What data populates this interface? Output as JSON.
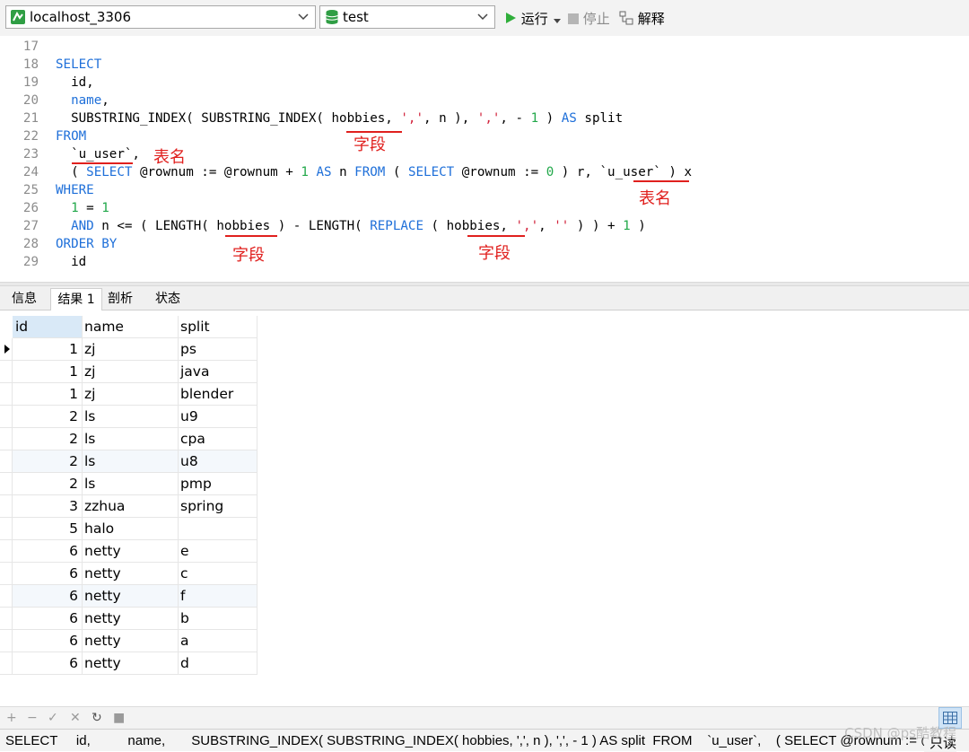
{
  "toolbar": {
    "connection": "localhost_3306",
    "database": "test",
    "run_label": "运行",
    "stop_label": "停止",
    "explain_label": "解释"
  },
  "editor": {
    "lines": [
      {
        "n": "17",
        "html": ""
      },
      {
        "n": "18",
        "html": "<span class='kw'>SELECT</span>"
      },
      {
        "n": "19",
        "html": "  id,"
      },
      {
        "n": "20",
        "html": "  <span class='kw'>name</span>,"
      },
      {
        "n": "21",
        "html": "  SUBSTRING_INDEX( SUBSTRING_INDEX( hobbies, <span class='str'>','</span>, n ), <span class='str'>','</span>, - <span class='num'>1</span> ) <span class='kw'>AS</span> split"
      },
      {
        "n": "22",
        "html": "<span class='kw'>FROM</span>"
      },
      {
        "n": "23",
        "html": "  `u_user`,"
      },
      {
        "n": "24",
        "html": "  ( <span class='kw'>SELECT</span> @rownum := @rownum + <span class='num'>1</span> <span class='kw'>AS</span> n <span class='kw'>FROM</span> ( <span class='kw'>SELECT</span> @rownum := <span class='num'>0</span> ) r, `u_user` ) x"
      },
      {
        "n": "25",
        "html": "<span class='kw'>WHERE</span>"
      },
      {
        "n": "26",
        "html": "  <span class='num'>1</span> = <span class='num'>1</span>"
      },
      {
        "n": "27",
        "html": "  <span class='kw'>AND</span> n <= ( LENGTH( hobbies ) - LENGTH( <span class='kw'>REPLACE</span> ( hobbies, <span class='str'>','</span>, <span class='str'>''</span> ) ) + <span class='num'>1</span> )"
      },
      {
        "n": "28",
        "html": "<span class='kw'>ORDER BY</span>"
      },
      {
        "n": "29",
        "html": "  id"
      }
    ],
    "annotations": {
      "field": "字段",
      "table": "表名"
    }
  },
  "tabs": [
    "信息",
    "结果 1",
    "剖析",
    "状态"
  ],
  "grid": {
    "columns": [
      "id",
      "name",
      "split"
    ],
    "rows": [
      {
        "id": "1",
        "name": "zj",
        "split": "ps"
      },
      {
        "id": "1",
        "name": "zj",
        "split": "java"
      },
      {
        "id": "1",
        "name": "zj",
        "split": "blender"
      },
      {
        "id": "2",
        "name": "ls",
        "split": "u9"
      },
      {
        "id": "2",
        "name": "ls",
        "split": "cpa"
      },
      {
        "id": "2",
        "name": "ls",
        "split": "u8"
      },
      {
        "id": "2",
        "name": "ls",
        "split": "pmp"
      },
      {
        "id": "3",
        "name": "zzhua",
        "split": "spring"
      },
      {
        "id": "5",
        "name": "halo",
        "split": ""
      },
      {
        "id": "6",
        "name": "netty",
        "split": "e"
      },
      {
        "id": "6",
        "name": "netty",
        "split": "c"
      },
      {
        "id": "6",
        "name": "netty",
        "split": "f"
      },
      {
        "id": "6",
        "name": "netty",
        "split": "b"
      },
      {
        "id": "6",
        "name": "netty",
        "split": "a"
      },
      {
        "id": "6",
        "name": "netty",
        "split": "d"
      }
    ]
  },
  "status": {
    "sql": "SELECT     id,          name,       SUBSTRING_INDEX( SUBSTRING_INDEX( hobbies, ',', n ), ',', - 1 ) AS split  FROM    `u_user`,    ( SELECT @rownum := @",
    "mode": "只读"
  },
  "watermark": "CSDN @ps酷教程"
}
